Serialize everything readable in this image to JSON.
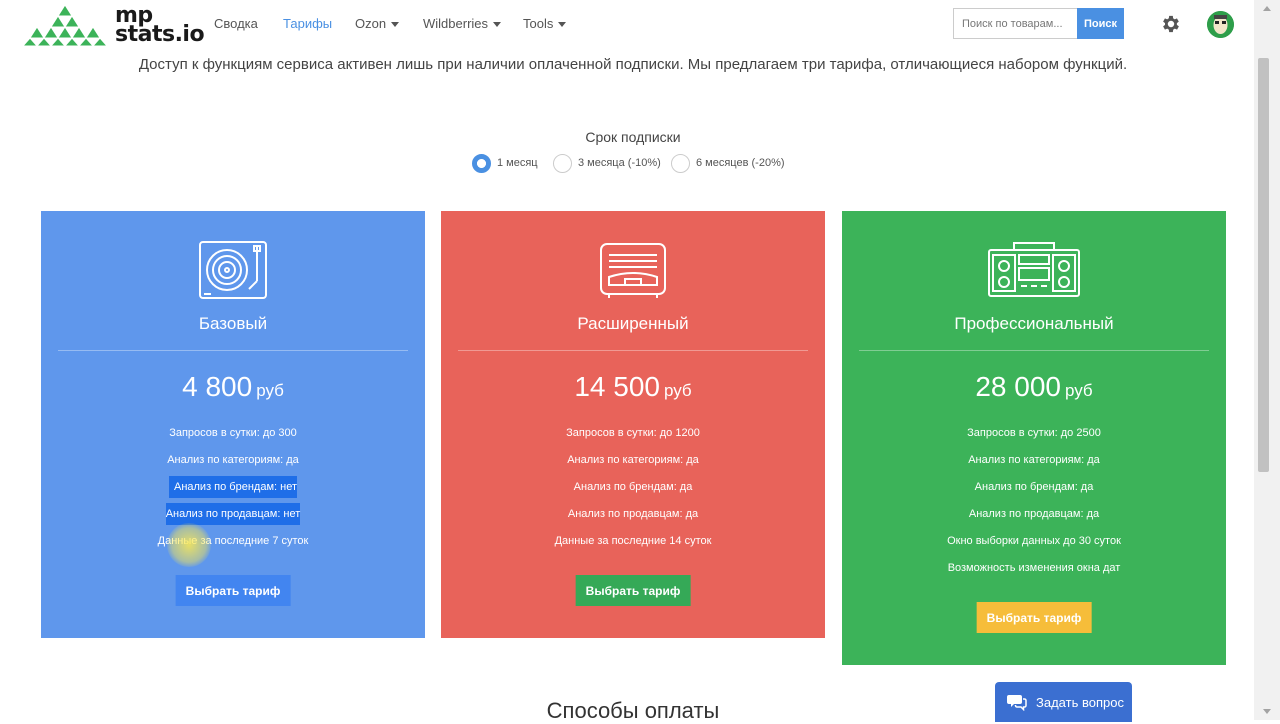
{
  "brand": {
    "logo_text_line1": "mp",
    "logo_text_line2": "stats.io"
  },
  "nav": {
    "items": [
      {
        "label": "Сводка"
      },
      {
        "label": "Тарифы"
      },
      {
        "label": "Ozon"
      },
      {
        "label": "Wildberries"
      },
      {
        "label": "Tools"
      }
    ],
    "active": "Тарифы",
    "search_placeholder": "Поиск по товарам...",
    "search_button": "Поиск"
  },
  "intro_text": "Доступ к функциям сервиса активен лишь при наличии оплаченной подписки. Мы предлагаем три тарифа, отличающиеся набором функций.",
  "subscription": {
    "label": "Срок подписки",
    "options": [
      {
        "label": "1 месяц",
        "selected": true
      },
      {
        "label": "3 месяца (-10%)",
        "selected": false
      },
      {
        "label": "6 месяцев (-20%)",
        "selected": false
      }
    ]
  },
  "plans": [
    {
      "name": "Базовый",
      "price": "4 800",
      "currency": "руб",
      "color": "#5f97ec",
      "button_color": "#4285f0",
      "icon": "turntable-icon",
      "features": [
        "Запросов в сутки: до 300",
        "Анализ по категориям: да",
        "Анализ по брендам: нет",
        "Анализ по продавцам: нет",
        "Данные за последние 7 суток"
      ],
      "button": "Выбрать тариф"
    },
    {
      "name": "Расширенный",
      "price": "14 500",
      "currency": "руб",
      "color": "#e8635a",
      "button_color": "#35a957",
      "icon": "radio-icon",
      "features": [
        "Запросов в сутки: до 1200",
        "Анализ по категориям: да",
        "Анализ по брендам: да",
        "Анализ по продавцам: да",
        "Данные за последние 14 суток"
      ],
      "button": "Выбрать тариф"
    },
    {
      "name": "Профессиональный",
      "price": "28 000",
      "currency": "руб",
      "color": "#3cb359",
      "button_color": "#f6bd3a",
      "icon": "boombox-icon",
      "features": [
        "Запросов в сутки: до 2500",
        "Анализ по категориям: да",
        "Анализ по брендам: да",
        "Анализ по продавцам: да",
        "Окно выборки данных до 30 суток",
        "Возможность изменения окна дат"
      ],
      "button": "Выбрать тариф"
    }
  ],
  "payment_title": "Способы оплаты",
  "ask_button": "Задать вопрос"
}
